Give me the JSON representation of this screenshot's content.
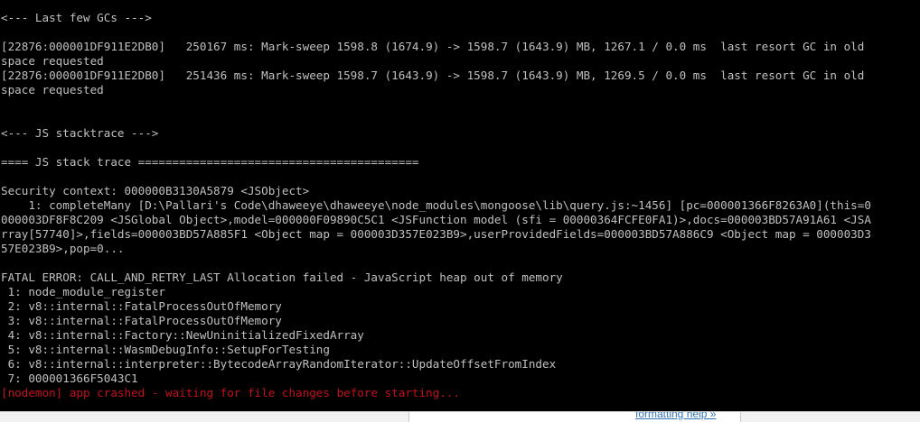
{
  "console": {
    "lines": [
      {
        "text": "<--- Last few GCs --->",
        "error": false
      },
      {
        "text": "",
        "error": false
      },
      {
        "text": "[22876:000001DF911E2DB0]   250167 ms: Mark-sweep 1598.8 (1674.9) -> 1598.7 (1643.9) MB, 1267.1 / 0.0 ms  last resort GC in old",
        "error": false
      },
      {
        "text": "space requested",
        "error": false
      },
      {
        "text": "[22876:000001DF911E2DB0]   251436 ms: Mark-sweep 1598.7 (1643.9) -> 1598.7 (1643.9) MB, 1269.5 / 0.0 ms  last resort GC in old",
        "error": false
      },
      {
        "text": "space requested",
        "error": false
      },
      {
        "text": "",
        "error": false
      },
      {
        "text": "",
        "error": false
      },
      {
        "text": "<--- JS stacktrace --->",
        "error": false
      },
      {
        "text": "",
        "error": false
      },
      {
        "text": "==== JS stack trace =========================================",
        "error": false
      },
      {
        "text": "",
        "error": false
      },
      {
        "text": "Security context: 000000B3130A5879 <JSObject>",
        "error": false
      },
      {
        "text": "    1: completeMany [D:\\Pallari's Code\\dhaweeye\\dhaweeye\\node_modules\\mongoose\\lib\\query.js:~1456] [pc=000001366F8263A0](this=0",
        "error": false
      },
      {
        "text": "000003DF8F8C209 <JSGlobal Object>,model=000000F09890C5C1 <JSFunction model (sfi = 00000364FCFE0FA1)>,docs=000003BD57A91A61 <JSA",
        "error": false
      },
      {
        "text": "rray[57740]>,fields=000003BD57A885F1 <Object map = 000003D357E023B9>,userProvidedFields=000003BD57A886C9 <Object map = 000003D3",
        "error": false
      },
      {
        "text": "57E023B9>,pop=0...",
        "error": false
      },
      {
        "text": "",
        "error": false
      },
      {
        "text": "FATAL ERROR: CALL_AND_RETRY_LAST Allocation failed - JavaScript heap out of memory",
        "error": false
      },
      {
        "text": " 1: node_module_register",
        "error": false
      },
      {
        "text": " 2: v8::internal::FatalProcessOutOfMemory",
        "error": false
      },
      {
        "text": " 3: v8::internal::FatalProcessOutOfMemory",
        "error": false
      },
      {
        "text": " 4: v8::internal::Factory::NewUninitializedFixedArray",
        "error": false
      },
      {
        "text": " 5: v8::internal::WasmDebugInfo::SetupForTesting",
        "error": false
      },
      {
        "text": " 6: v8::internal::interpreter::BytecodeArrayRandomIterator::UpdateOffsetFromIndex",
        "error": false
      },
      {
        "text": " 7: 000001366F5043C1",
        "error": false
      },
      {
        "text": "[nodemon] app crashed - waiting for file changes before starting...",
        "error": true
      }
    ]
  },
  "background_page": {
    "help_link": "formatting help »"
  },
  "colors": {
    "console_bg": "#000000",
    "console_text": "#c0c0c0",
    "error_text": "#c50f1f",
    "link": "#3173b9"
  }
}
